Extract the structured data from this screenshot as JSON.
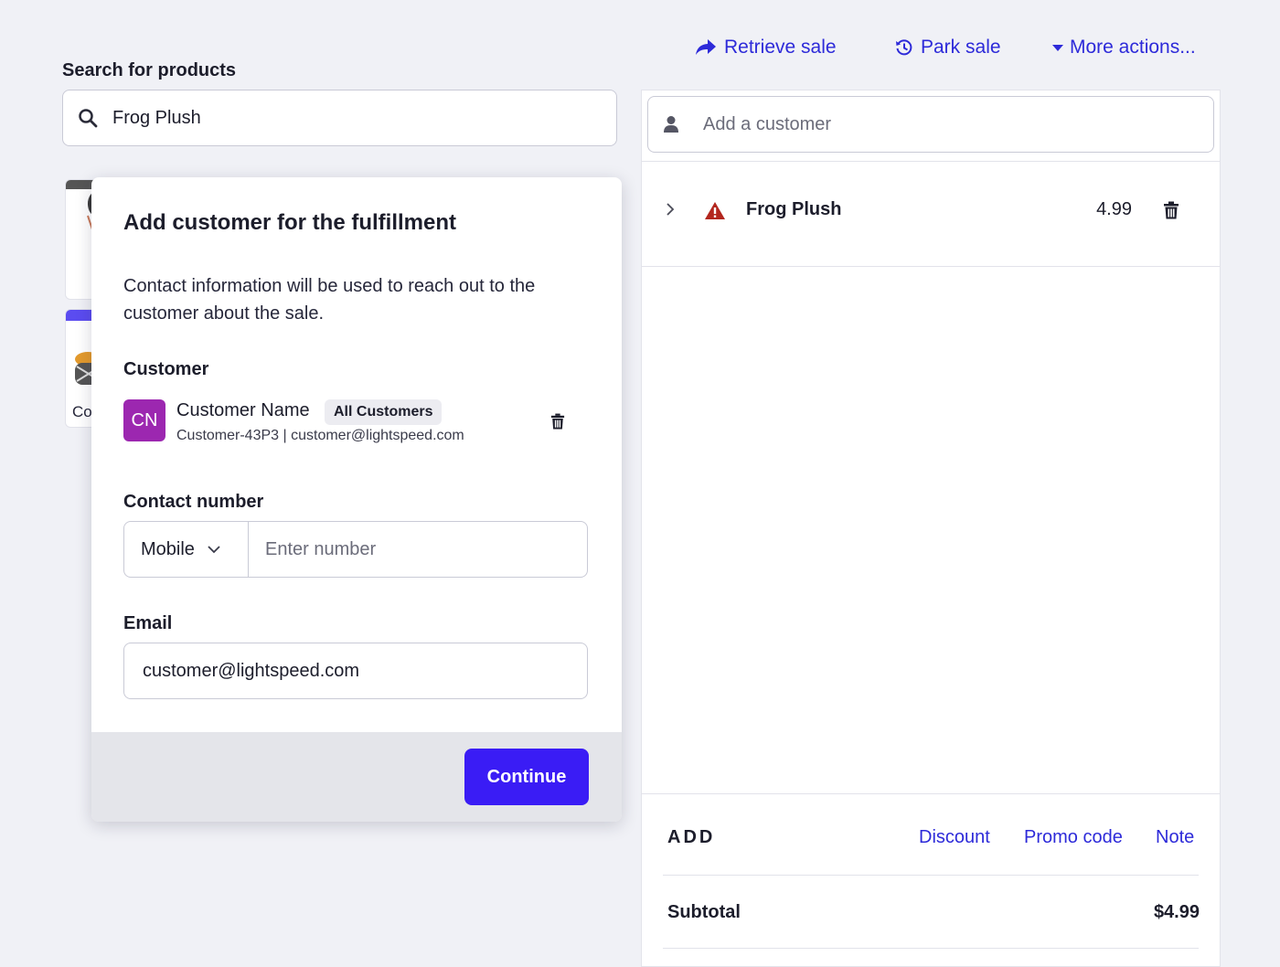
{
  "top_actions": {
    "retrieve_sale": "Retrieve sale",
    "park_sale": "Park sale",
    "more_actions": "More actions..."
  },
  "search": {
    "label": "Search for products",
    "value": "Frog Plush"
  },
  "background_cards": {
    "peek_label": "Co"
  },
  "cart": {
    "customer_placeholder": "Add a customer",
    "items": [
      {
        "name": "Frog Plush",
        "price": "4.99",
        "status": "warning"
      }
    ],
    "add": {
      "label": "ADD",
      "links": [
        "Discount",
        "Promo code",
        "Note"
      ]
    },
    "subtotal": {
      "label": "Subtotal",
      "value": "$4.99"
    }
  },
  "modal": {
    "title": "Add customer for the fulfillment",
    "description": "Contact information will be used to reach out to the customer about the sale.",
    "customer_section": "Customer",
    "customer": {
      "initials": "CN",
      "name": "Customer Name",
      "group": "All Customers",
      "details": "Customer-43P3 | customer@lightspeed.com",
      "avatar_color": "#9c27b0"
    },
    "contact_section": "Contact number",
    "phone_type": "Mobile",
    "phone_placeholder": "Enter number",
    "email_section": "Email",
    "email_value": "customer@lightspeed.com",
    "continue_label": "Continue"
  },
  "colors": {
    "accent": "#2d2ad9",
    "primary_button": "#3a1cf5",
    "warning": "#b3261e"
  }
}
